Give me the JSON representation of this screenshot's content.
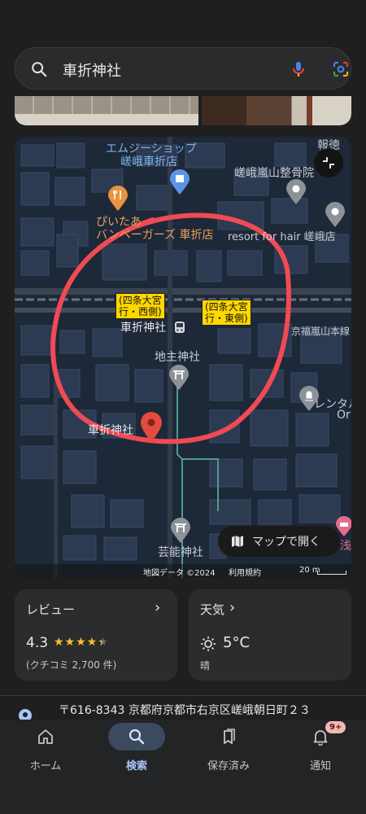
{
  "search": {
    "query": "車折神社"
  },
  "map": {
    "labels": {
      "mg_shop_1": "エムジーショップ",
      "mg_shop_2": "嵯峨車折店",
      "piitaa_1": "ぴいたあ",
      "piitaa_2": "バンベーガーズ 車折店",
      "seikotsu": "嵯峨嵐山整骨院",
      "hair": "resort for hair 嵯峨店",
      "hokyo": "報徳",
      "station": "車折神社",
      "line": "京福嵐山本線",
      "jishu": "地主神社",
      "main_pin": "車折神社",
      "geino": "芸能神社",
      "rental_1": "レンタル",
      "rental_2": "Or",
      "asaki": "浅見"
    },
    "bus_stop_west": [
      "四条大宮",
      "行・西側)"
    ],
    "bus_stop_west_prefix": "(",
    "bus_stop_east": [
      "(四条大宮",
      "行・東側)"
    ],
    "open_map_label": "マップで開く",
    "attribution": "地図データ ©2024",
    "terms": "利用規約",
    "scale": "20 m"
  },
  "review": {
    "title": "レビュー",
    "rating": "4.3",
    "stars": 4.3,
    "count": "(クチコミ 2,700 件)"
  },
  "weather": {
    "title": "天気",
    "temp": "5°C",
    "condition": "晴"
  },
  "address": "〒616-8343 京都府京都市右京区嵯峨朝日町２３",
  "nav": {
    "home": "ホーム",
    "search": "検索",
    "saved": "保存済み",
    "notifications": "通知",
    "badge": "9+"
  },
  "colors": {
    "accent": "#a8c7fa",
    "annotation": "#f04a55",
    "star": "#fbc02d",
    "bus_tag": "#ffd800"
  }
}
